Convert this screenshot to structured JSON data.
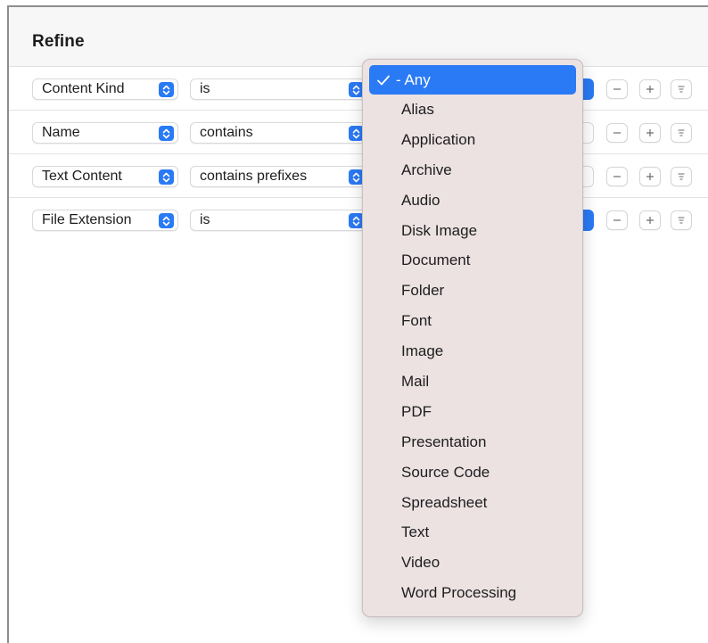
{
  "header": {
    "title": "Refine"
  },
  "rules": [
    {
      "attribute": "Content Kind",
      "operator": "is",
      "value_active": true
    },
    {
      "attribute": "Name",
      "operator": "contains",
      "value_active": false
    },
    {
      "attribute": "Text Content",
      "operator": "contains prefixes",
      "value_active": false
    },
    {
      "attribute": "File Extension",
      "operator": "is",
      "value_active": true
    }
  ],
  "buttons": {
    "minus": "−",
    "plus": "+"
  },
  "menu": {
    "selected": "- Any",
    "items": [
      "- Any",
      "Alias",
      "Application",
      "Archive",
      "Audio",
      "Disk Image",
      "Document",
      "Folder",
      "Font",
      "Image",
      "Mail",
      "PDF",
      "Presentation",
      "Source Code",
      "Spreadsheet",
      "Text",
      "Video",
      "Word Processing"
    ]
  },
  "colors": {
    "accent": "#2a7af5",
    "menu_bg": "#ece2e2"
  },
  "icons": {
    "popup": "chevron-up-down-icon",
    "check": "checkmark-icon",
    "more": "list-icon"
  }
}
